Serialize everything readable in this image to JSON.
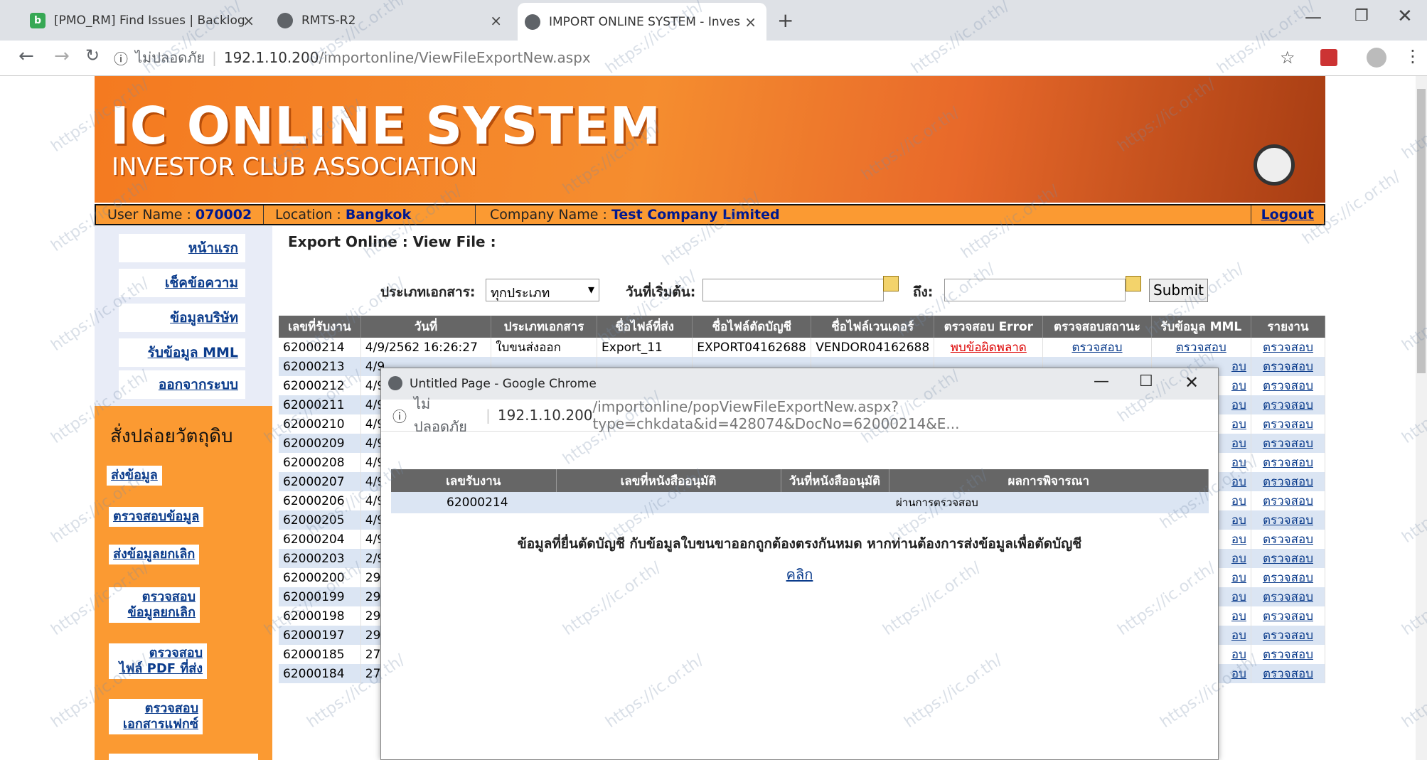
{
  "browser": {
    "tabs": [
      {
        "label": "[PMO_RM] Find Issues | Backlog",
        "icon": "backlog-icon",
        "active": false
      },
      {
        "label": "RMTS-R2",
        "icon": "globe-icon",
        "active": false
      },
      {
        "label": "IMPORT ONLINE SYSTEM - Inves",
        "icon": "globe-icon",
        "active": true
      }
    ],
    "address": {
      "security": "ไม่ปลอดภัย",
      "host": "192.1.10.200",
      "path": "/importonline/ViewFileExportNew.aspx"
    }
  },
  "banner": {
    "title": "IC ONLINE SYSTEM",
    "subtitle": "INVESTOR CLUB ASSOCIATION"
  },
  "infobar": {
    "user_label": "User Name :",
    "user_value": "070002",
    "location_label": "Location :",
    "location_value": "Bangkok",
    "company_label": "Company Name :",
    "company_value": "Test Company Limited",
    "logout": "Logout"
  },
  "sidebar": {
    "menu": [
      "หน้าแรก",
      "เช็คข้อความ",
      "ข้อมูลบริษัท",
      "รับข้อมูล MML",
      "ออกจากระบบ"
    ],
    "section_title": "สั่งปล่อยวัตถุดิบ",
    "actions": [
      "ส่งข้อมูล",
      "ตรวจสอบข้อมูล",
      "ส่งข้อมูลยกเลิก",
      "ตรวจสอบ",
      "ข้อมูลยกเลิก",
      "ตรวจสอบ",
      "ไฟล์ PDF ที่ส่ง",
      "ตรวจสอบ",
      "เอกสารแฟกซ์"
    ]
  },
  "main": {
    "title": "Export Online : View File :",
    "filter": {
      "doc_type_label": "ประเภทเอกสาร:",
      "doc_type_value": "ทุกประเภท",
      "start_label": "วันที่เริ่มต้น:",
      "to_label": "ถึง:",
      "submit": "Submit"
    },
    "columns": [
      "เลขที่รับงาน",
      "วันที่",
      "ประเภทเอกสาร",
      "ชื่อไฟล์ที่ส่ง",
      "ชื่อไฟล์ตัดบัญชี",
      "ชื่อไฟล์เวนเดอร์",
      "ตรวจสอบ Error",
      "ตรวจสอบสถานะ",
      "รับข้อมูล MML",
      "รายงาน"
    ],
    "first_row": {
      "date": "4/9/2562 16:26:27",
      "doc_type": "ใบขนส่งออก",
      "file": "Export_11",
      "cut_file": "EXPORT04162688",
      "vendor_file": "VENDOR04162688",
      "error": "พบข้อผิดพลาด",
      "status": "ตรวจสอบ",
      "mml": "ตรวจสอบ",
      "report": "ตรวจสอบ"
    },
    "rows": [
      {
        "no": "62000214",
        "date": "4/9/2562 16:26:27"
      },
      {
        "no": "62000213",
        "date": "4/9"
      },
      {
        "no": "62000212",
        "date": "4/9"
      },
      {
        "no": "62000211",
        "date": "4/9"
      },
      {
        "no": "62000210",
        "date": "4/9"
      },
      {
        "no": "62000209",
        "date": "4/9"
      },
      {
        "no": "62000208",
        "date": "4/9"
      },
      {
        "no": "62000207",
        "date": "4/9"
      },
      {
        "no": "62000206",
        "date": "4/9"
      },
      {
        "no": "62000205",
        "date": "4/9"
      },
      {
        "no": "62000204",
        "date": "4/9"
      },
      {
        "no": "62000203",
        "date": "2/9"
      },
      {
        "no": "62000200",
        "date": "29,"
      },
      {
        "no": "62000199",
        "date": "29,"
      },
      {
        "no": "62000198",
        "date": "29,"
      },
      {
        "no": "62000197",
        "date": "29,"
      },
      {
        "no": "62000185",
        "date": "27,"
      },
      {
        "no": "62000184",
        "date": "27,"
      }
    ],
    "partial_mml": "อบ",
    "report_link": "ตรวจสอบ"
  },
  "popup": {
    "title": "Untitled Page - Google Chrome",
    "security": "ไม่ปลอดภัย",
    "host": "192.1.10.200",
    "path": "/importonline/popViewFileExportNew.aspx?type=chkdata&id=428074&DocNo=62000214&E...",
    "columns": [
      "เลขรับงาน",
      "เลขที่หนังสืออนุมัติ",
      "วันที่หนังสืออนุมัติ",
      "ผลการพิจารณา"
    ],
    "row": {
      "no": "62000214",
      "approval_no": "",
      "approval_date": "",
      "result": "ผ่านการตรวจสอบ"
    },
    "message": "ข้อมูลที่ยื่นตัดบัญชี กับข้อมูลใบขนขาออกถูกต้องตรงกันหมด หากท่านต้องการส่งข้อมูลเพื่อตัดบัญชี",
    "link": "คลิก"
  },
  "watermark": "https://ic.or.th/"
}
